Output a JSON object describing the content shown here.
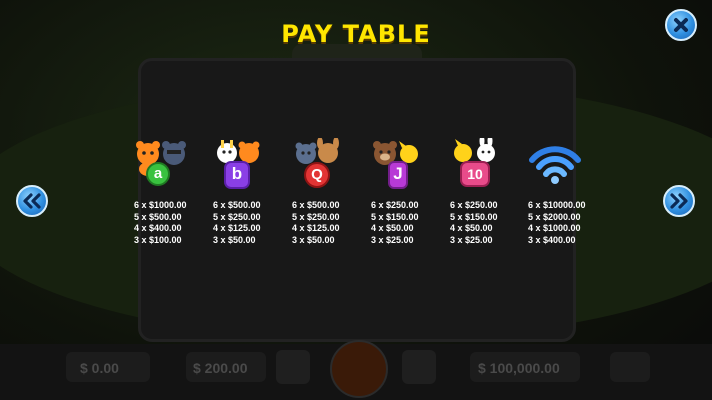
{
  "title": "PAY TABLE",
  "icons": {
    "close": "close-x-icon",
    "prev": "double-chevron-left-icon",
    "next": "double-chevron-right-icon",
    "wild": "wifi-signal-icon"
  },
  "colors": {
    "title": "#ffe600",
    "button_blue": "#2f8fe0",
    "pay_text": "#ffffff"
  },
  "symbols": [
    {
      "name": "letter-a-symbol",
      "letter": "a",
      "pays": [
        "6 x $1000.00",
        "5 x $500.00",
        "4 x $400.00",
        "3 x $100.00"
      ]
    },
    {
      "name": "letter-b-symbol",
      "letter": "b",
      "pays": [
        "6 x $500.00",
        "5 x $250.00",
        "4 x $125.00",
        "3 x $50.00"
      ]
    },
    {
      "name": "letter-q-symbol",
      "letter": "Q",
      "pays": [
        "6 x $500.00",
        "5 x $250.00",
        "4 x $125.00",
        "3 x $50.00"
      ]
    },
    {
      "name": "letter-j-symbol",
      "letter": "J",
      "pays": [
        "6 x $250.00",
        "5 x $150.00",
        "4 x $50.00",
        "3 x $25.00"
      ]
    },
    {
      "name": "number-10-symbol",
      "letter": "10",
      "pays": [
        "6 x $250.00",
        "5 x $150.00",
        "4 x $50.00",
        "3 x $25.00"
      ]
    },
    {
      "name": "wifi-wild-symbol",
      "letter": "",
      "pays": [
        "6 x $10000.00",
        "5 x $2000.00",
        "4 x $1000.00",
        "3 x $400.00"
      ]
    }
  ],
  "background_bar": {
    "credit": "$ 0.00",
    "total_bet": "$ 200.00",
    "win": "$ 100,000.00"
  }
}
